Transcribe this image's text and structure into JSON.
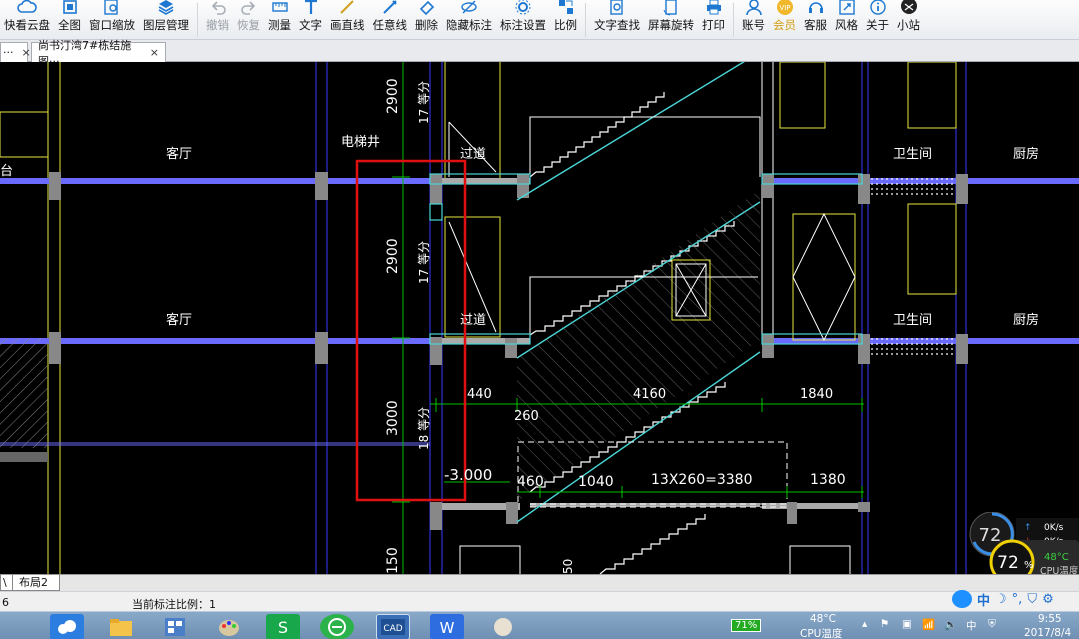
{
  "toolbar": {
    "items": [
      {
        "label": "快看云盘",
        "icon": "cloud-icon"
      },
      {
        "label": "全图",
        "icon": "fullview-icon"
      },
      {
        "label": "窗口缩放",
        "icon": "window-zoom-icon"
      },
      {
        "label": "图层管理",
        "icon": "layers-icon"
      },
      {
        "label": "撤销",
        "icon": "undo-icon",
        "disabled": true
      },
      {
        "label": "恢复",
        "icon": "redo-icon",
        "disabled": true
      },
      {
        "label": "测量",
        "icon": "measure-icon"
      },
      {
        "label": "文字",
        "icon": "text-icon"
      },
      {
        "label": "画直线",
        "icon": "line-icon"
      },
      {
        "label": "任意线",
        "icon": "freeline-icon"
      },
      {
        "label": "删除",
        "icon": "eraser-icon"
      },
      {
        "label": "隐藏标注",
        "icon": "hide-annotation-icon"
      },
      {
        "label": "标注设置",
        "icon": "annotation-settings-icon"
      },
      {
        "label": "比例",
        "icon": "scale-icon"
      },
      {
        "label": "文字查找",
        "icon": "text-search-icon"
      },
      {
        "label": "屏幕旋转",
        "icon": "rotate-screen-icon"
      },
      {
        "label": "打印",
        "icon": "print-icon"
      },
      {
        "label": "账号",
        "icon": "account-icon"
      },
      {
        "label": "会员",
        "icon": "vip-icon"
      },
      {
        "label": "客服",
        "icon": "headset-icon"
      },
      {
        "label": "风格",
        "icon": "style-icon"
      },
      {
        "label": "关于",
        "icon": "info-icon"
      },
      {
        "label": "小站",
        "icon": "station-icon"
      }
    ]
  },
  "tabs": {
    "first_label": "···",
    "active_label": "尚书汀湾7#栋结施图···",
    "close": "×"
  },
  "drawing": {
    "rooms": {
      "keting": "客厅",
      "diantijing": "电梯井",
      "guodao": "过道",
      "weishengjian": "卫生间",
      "chufang": "厨房",
      "tai": "台"
    },
    "dims": {
      "d2900": "2900",
      "d3000": "3000",
      "d150": "150",
      "steps17": "17 等分",
      "steps18": "18 等分",
      "d440": "440",
      "d4160": "4160",
      "d1840": "1840",
      "d260": "260",
      "d460": "460",
      "d1040": "1040",
      "d13x260": "13X260=3380",
      "d1380": "1380",
      "elev": "-3.000",
      "d50": "50"
    },
    "colors": {
      "highlight": "#e01010",
      "wall": "#4ad6d6",
      "slab": "#8a8aff",
      "dimension": "#00c000",
      "line": "#ffffff",
      "yellow": "#e6e640"
    }
  },
  "layout_tabs": {
    "prev": "\\",
    "tab2": "布局2"
  },
  "status": {
    "left": "6",
    "scale_text": "当前标注比例：1"
  },
  "cpu": {
    "small_percent": "72",
    "big_percent": "72",
    "percent_sign": "%",
    "net_up": "0K/s",
    "net_down": "0K/s",
    "temp": "48°C",
    "temp_label": "CPU温度"
  },
  "tray": {
    "battery": "71%",
    "temp": "48°C",
    "temp_label": "CPU温度",
    "ime": "中",
    "time": "9:55",
    "date": "2017/8/4",
    "ime_bar": "中"
  }
}
